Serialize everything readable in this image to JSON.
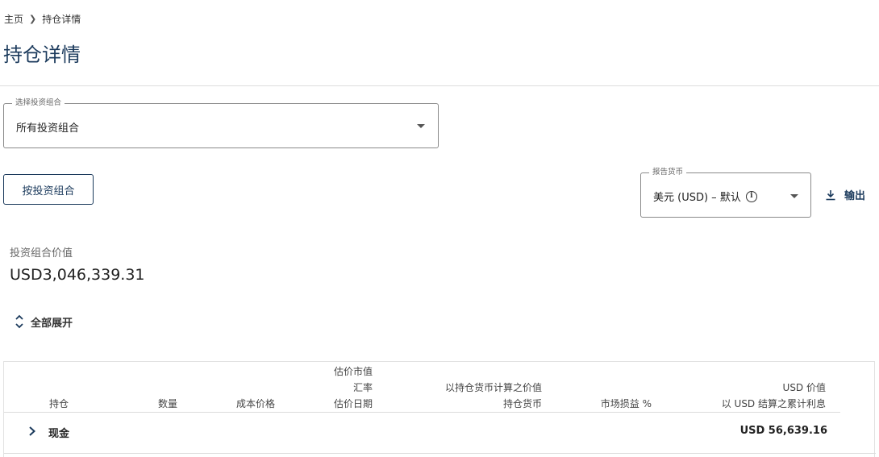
{
  "breadcrumb": {
    "home": "主页",
    "current": "持仓详情"
  },
  "page_title": "持仓详情",
  "portfolio_select": {
    "legend": "选择投资组合",
    "value": "所有投资组合"
  },
  "by_portfolio_button": "按投资组合",
  "currency_select": {
    "legend": "报告货币",
    "value": "美元 (USD) – 默认",
    "info_glyph": "i"
  },
  "export_label": "输出",
  "portfolio_value": {
    "label": "投资组合价值",
    "value": "USD3,046,339.31"
  },
  "expand_all_label": "全部展开",
  "table": {
    "headers": {
      "holding": "持仓",
      "quantity": "数量",
      "cost_price": "成本价格",
      "valuation": [
        "估价市值",
        "汇率",
        "估价日期"
      ],
      "holding_currency": [
        "以持仓货币计算之价值",
        "持仓货币"
      ],
      "market_pl": "市场损益 %",
      "usd_value": [
        "USD 价值",
        "以 USD 结算之累计利息"
      ]
    },
    "rows": [
      {
        "name": "现金",
        "amount": "USD 56,639.16"
      }
    ]
  },
  "colors": {
    "primary": "#1b3a5c",
    "divider": "#dcdcdc"
  }
}
